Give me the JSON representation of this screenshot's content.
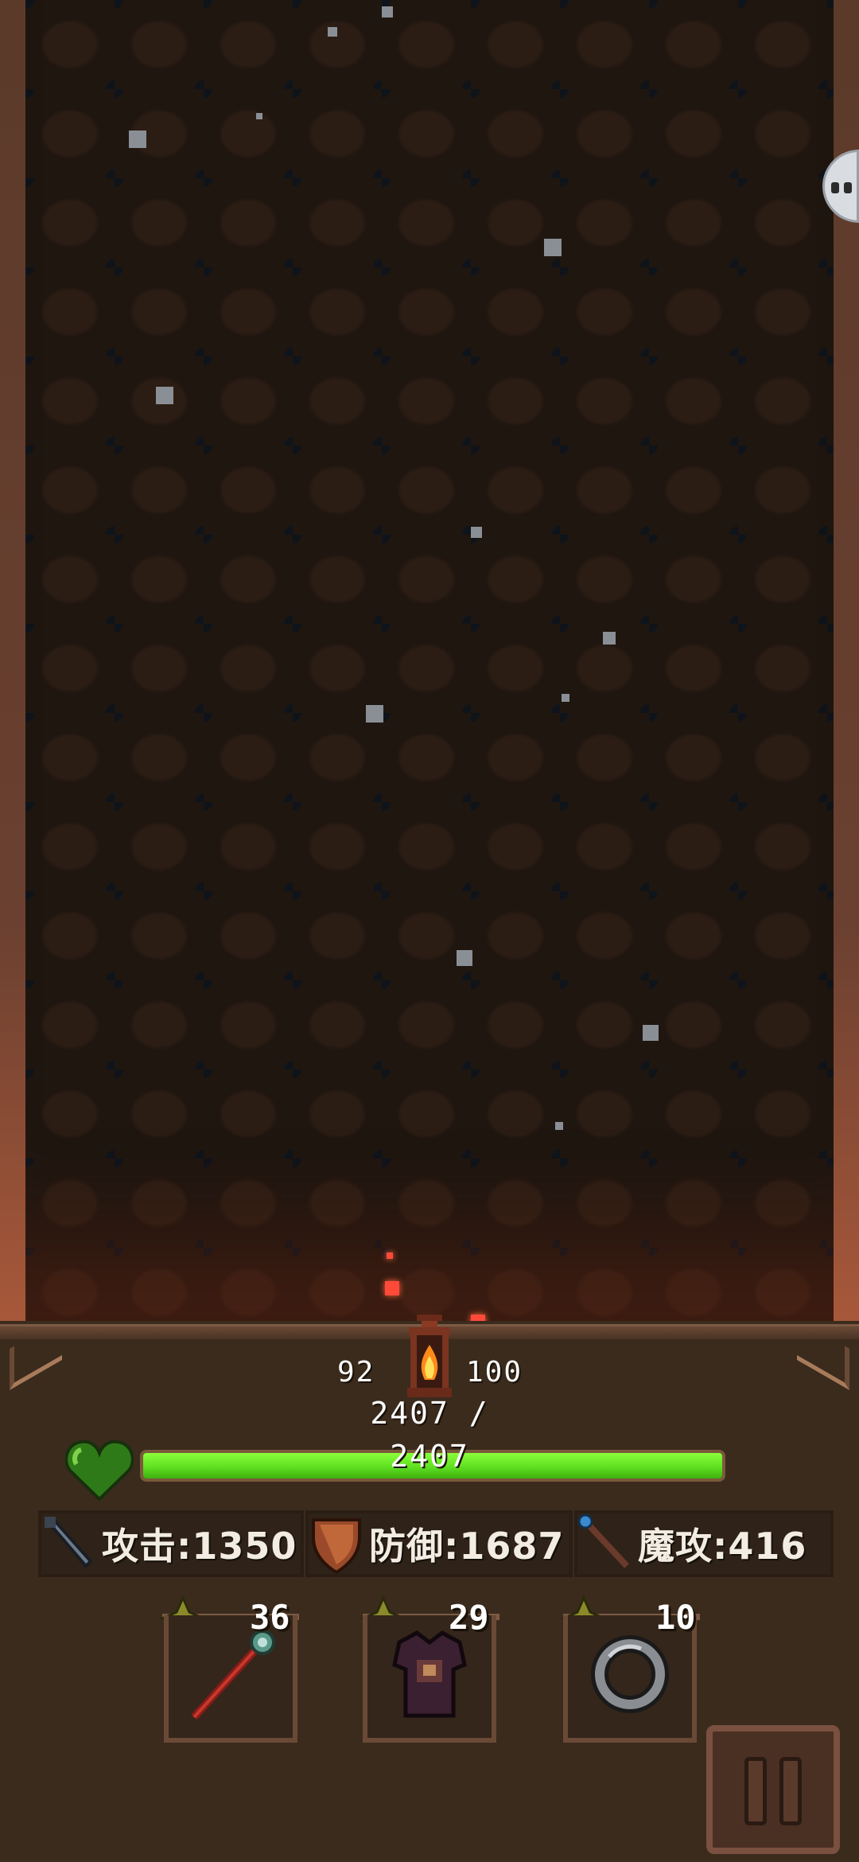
{
  "lantern": {
    "current": "92",
    "max": "100"
  },
  "hp": {
    "current": "2407",
    "max": "2407",
    "current_line": "2407 /",
    "max_line": "2407",
    "fill_fraction": 1.0
  },
  "stats": {
    "attack": "攻击:1350",
    "defense": "防御:1687",
    "magic": "魔攻:416"
  },
  "equipment": [
    {
      "name": "staff",
      "count": "36"
    },
    {
      "name": "armor",
      "count": "29"
    },
    {
      "name": "ring",
      "count": "10"
    }
  ],
  "colors": {
    "hp_fill": "#5fe020",
    "heart": "#3aa020",
    "panel": "#3b2b1d",
    "dungeon_floor": "#1f1610"
  },
  "icons": [
    "heart-icon",
    "sword-icon",
    "shield-icon",
    "wand-icon",
    "staff-icon",
    "armor-icon",
    "ring-icon",
    "lantern-icon",
    "pause-icon"
  ]
}
